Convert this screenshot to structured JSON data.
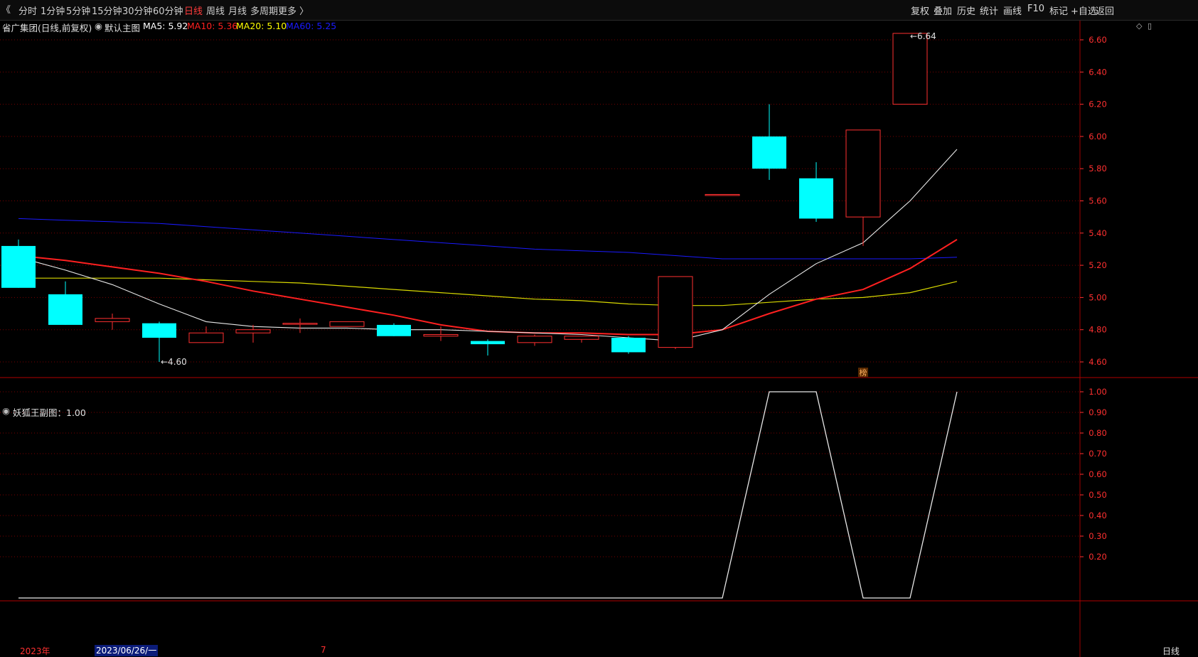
{
  "toolbar": {
    "nav_icon": "double-chevron-left-icon",
    "periods": [
      {
        "label": "分时"
      },
      {
        "label": "1分钟"
      },
      {
        "label": "5分钟"
      },
      {
        "label": "15分钟"
      },
      {
        "label": "30分钟"
      },
      {
        "label": "60分钟"
      },
      {
        "label": "日线",
        "active": true
      },
      {
        "label": "周线"
      },
      {
        "label": "月线"
      },
      {
        "label": "多周期"
      },
      {
        "label": "更多 〉"
      }
    ],
    "right": [
      "复权",
      "叠加",
      "历史",
      "统计",
      "画线",
      "F10",
      "标记",
      "+自选",
      "返回"
    ]
  },
  "main_panel": {
    "stock_title": "省广集团(日线,前复权)",
    "template_label": "默认主图",
    "ma": [
      {
        "label": "MA5: 5.92",
        "color": "#ffffff"
      },
      {
        "label": "MA10: 5.36",
        "color": "#ff2020"
      },
      {
        "label": "MA20: 5.10",
        "color": "#ffff00"
      },
      {
        "label": "MA60: 5.25",
        "color": "#1a1aff"
      }
    ],
    "y_ticks": [
      "6.60",
      "6.40",
      "6.20",
      "6.00",
      "5.80",
      "5.60",
      "5.40",
      "5.20",
      "5.00",
      "4.80",
      "4.60"
    ],
    "low_marker": "4.60",
    "high_marker": "6.64",
    "badge": "榜"
  },
  "sub_panel": {
    "title": "妖狐王副图：1.00",
    "y_ticks": [
      "1.00",
      "0.90",
      "0.80",
      "0.70",
      "0.60",
      "0.50",
      "0.40",
      "0.30",
      "0.20"
    ],
    "values": [
      0,
      0,
      0,
      0,
      0,
      0,
      0,
      0,
      0,
      0,
      0,
      0,
      0,
      0,
      0,
      1,
      1,
      0,
      0,
      1
    ]
  },
  "footer": {
    "year_label": "2023年",
    "date_label": "2023/06/26/一",
    "month_label": "7",
    "period_label": "日线"
  },
  "colors": {
    "up": "#ff3030",
    "down": "#00ffff",
    "grid": "#7a0000",
    "axis_text": "#ff3030",
    "active": "#ff3b3b"
  },
  "chart_data": {
    "type": "candlestick",
    "candles": [
      {
        "o": 5.32,
        "h": 5.36,
        "l": 5.06,
        "c": 5.06
      },
      {
        "o": 5.02,
        "h": 5.1,
        "l": 4.83,
        "c": 4.83
      },
      {
        "o": 4.85,
        "h": 4.9,
        "l": 4.8,
        "c": 4.87
      },
      {
        "o": 4.84,
        "h": 4.85,
        "l": 4.6,
        "c": 4.75
      },
      {
        "o": 4.72,
        "h": 4.82,
        "l": 4.72,
        "c": 4.78
      },
      {
        "o": 4.78,
        "h": 4.83,
        "l": 4.72,
        "c": 4.8
      },
      {
        "o": 4.84,
        "h": 4.87,
        "l": 4.78,
        "c": 4.84
      },
      {
        "o": 4.82,
        "h": 4.85,
        "l": 4.82,
        "c": 4.85
      },
      {
        "o": 4.83,
        "h": 4.84,
        "l": 4.76,
        "c": 4.76
      },
      {
        "o": 4.76,
        "h": 4.82,
        "l": 4.73,
        "c": 4.77
      },
      {
        "o": 4.73,
        "h": 4.74,
        "l": 4.64,
        "c": 4.71
      },
      {
        "o": 4.72,
        "h": 4.77,
        "l": 4.7,
        "c": 4.76
      },
      {
        "o": 4.74,
        "h": 4.76,
        "l": 4.72,
        "c": 4.76
      },
      {
        "o": 4.75,
        "h": 4.76,
        "l": 4.65,
        "c": 4.66
      },
      {
        "o": 4.69,
        "h": 5.13,
        "l": 4.68,
        "c": 5.13
      },
      {
        "o": 5.64,
        "h": 5.64,
        "l": 5.64,
        "c": 5.64
      },
      {
        "o": 6.0,
        "h": 6.2,
        "l": 5.73,
        "c": 5.8
      },
      {
        "o": 5.74,
        "h": 5.84,
        "l": 5.47,
        "c": 5.49
      },
      {
        "o": 5.5,
        "h": 6.04,
        "l": 5.32,
        "c": 6.04
      },
      {
        "o": 6.2,
        "h": 6.64,
        "l": 6.2,
        "c": 6.64
      }
    ],
    "ma5": [
      5.25,
      5.17,
      5.08,
      4.96,
      4.85,
      4.82,
      4.81,
      4.81,
      4.8,
      4.8,
      4.79,
      4.78,
      4.77,
      4.75,
      4.73,
      4.8,
      5.02,
      5.21,
      5.34,
      5.6,
      5.92
    ],
    "ma10": [
      5.26,
      5.23,
      5.19,
      5.15,
      5.1,
      5.04,
      4.99,
      4.94,
      4.89,
      4.83,
      4.79,
      4.78,
      4.78,
      4.77,
      4.77,
      4.8,
      4.9,
      4.99,
      5.05,
      5.18,
      5.36
    ],
    "ma20": [
      5.12,
      5.12,
      5.12,
      5.12,
      5.11,
      5.1,
      5.09,
      5.07,
      5.05,
      5.03,
      5.01,
      4.99,
      4.98,
      4.96,
      4.95,
      4.95,
      4.97,
      4.99,
      5.0,
      5.03,
      5.1
    ],
    "ma60": [
      5.49,
      5.48,
      5.47,
      5.46,
      5.44,
      5.42,
      5.4,
      5.38,
      5.36,
      5.34,
      5.32,
      5.3,
      5.29,
      5.28,
      5.26,
      5.24,
      5.24,
      5.24,
      5.24,
      5.24,
      5.25
    ],
    "ylim": [
      4.55,
      6.7
    ]
  }
}
